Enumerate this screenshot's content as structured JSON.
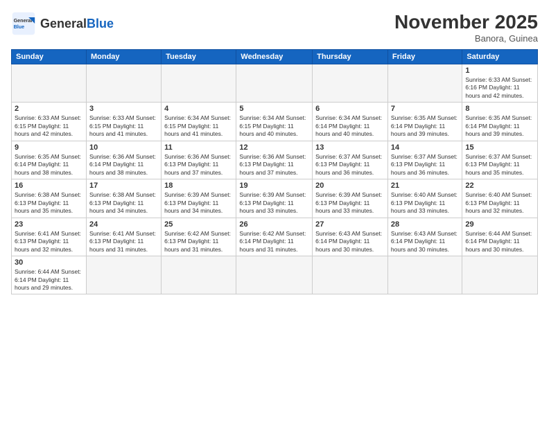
{
  "logo": {
    "text_general": "General",
    "text_blue": "Blue"
  },
  "header": {
    "month": "November 2025",
    "location": "Banora, Guinea"
  },
  "weekdays": [
    "Sunday",
    "Monday",
    "Tuesday",
    "Wednesday",
    "Thursday",
    "Friday",
    "Saturday"
  ],
  "weeks": [
    [
      {
        "day": "",
        "info": ""
      },
      {
        "day": "",
        "info": ""
      },
      {
        "day": "",
        "info": ""
      },
      {
        "day": "",
        "info": ""
      },
      {
        "day": "",
        "info": ""
      },
      {
        "day": "",
        "info": ""
      },
      {
        "day": "1",
        "info": "Sunrise: 6:33 AM\nSunset: 6:16 PM\nDaylight: 11 hours\nand 42 minutes."
      }
    ],
    [
      {
        "day": "2",
        "info": "Sunrise: 6:33 AM\nSunset: 6:15 PM\nDaylight: 11 hours\nand 42 minutes."
      },
      {
        "day": "3",
        "info": "Sunrise: 6:33 AM\nSunset: 6:15 PM\nDaylight: 11 hours\nand 41 minutes."
      },
      {
        "day": "4",
        "info": "Sunrise: 6:34 AM\nSunset: 6:15 PM\nDaylight: 11 hours\nand 41 minutes."
      },
      {
        "day": "5",
        "info": "Sunrise: 6:34 AM\nSunset: 6:15 PM\nDaylight: 11 hours\nand 40 minutes."
      },
      {
        "day": "6",
        "info": "Sunrise: 6:34 AM\nSunset: 6:14 PM\nDaylight: 11 hours\nand 40 minutes."
      },
      {
        "day": "7",
        "info": "Sunrise: 6:35 AM\nSunset: 6:14 PM\nDaylight: 11 hours\nand 39 minutes."
      },
      {
        "day": "8",
        "info": "Sunrise: 6:35 AM\nSunset: 6:14 PM\nDaylight: 11 hours\nand 39 minutes."
      }
    ],
    [
      {
        "day": "9",
        "info": "Sunrise: 6:35 AM\nSunset: 6:14 PM\nDaylight: 11 hours\nand 38 minutes."
      },
      {
        "day": "10",
        "info": "Sunrise: 6:36 AM\nSunset: 6:14 PM\nDaylight: 11 hours\nand 38 minutes."
      },
      {
        "day": "11",
        "info": "Sunrise: 6:36 AM\nSunset: 6:13 PM\nDaylight: 11 hours\nand 37 minutes."
      },
      {
        "day": "12",
        "info": "Sunrise: 6:36 AM\nSunset: 6:13 PM\nDaylight: 11 hours\nand 37 minutes."
      },
      {
        "day": "13",
        "info": "Sunrise: 6:37 AM\nSunset: 6:13 PM\nDaylight: 11 hours\nand 36 minutes."
      },
      {
        "day": "14",
        "info": "Sunrise: 6:37 AM\nSunset: 6:13 PM\nDaylight: 11 hours\nand 36 minutes."
      },
      {
        "day": "15",
        "info": "Sunrise: 6:37 AM\nSunset: 6:13 PM\nDaylight: 11 hours\nand 35 minutes."
      }
    ],
    [
      {
        "day": "16",
        "info": "Sunrise: 6:38 AM\nSunset: 6:13 PM\nDaylight: 11 hours\nand 35 minutes."
      },
      {
        "day": "17",
        "info": "Sunrise: 6:38 AM\nSunset: 6:13 PM\nDaylight: 11 hours\nand 34 minutes."
      },
      {
        "day": "18",
        "info": "Sunrise: 6:39 AM\nSunset: 6:13 PM\nDaylight: 11 hours\nand 34 minutes."
      },
      {
        "day": "19",
        "info": "Sunrise: 6:39 AM\nSunset: 6:13 PM\nDaylight: 11 hours\nand 33 minutes."
      },
      {
        "day": "20",
        "info": "Sunrise: 6:39 AM\nSunset: 6:13 PM\nDaylight: 11 hours\nand 33 minutes."
      },
      {
        "day": "21",
        "info": "Sunrise: 6:40 AM\nSunset: 6:13 PM\nDaylight: 11 hours\nand 33 minutes."
      },
      {
        "day": "22",
        "info": "Sunrise: 6:40 AM\nSunset: 6:13 PM\nDaylight: 11 hours\nand 32 minutes."
      }
    ],
    [
      {
        "day": "23",
        "info": "Sunrise: 6:41 AM\nSunset: 6:13 PM\nDaylight: 11 hours\nand 32 minutes."
      },
      {
        "day": "24",
        "info": "Sunrise: 6:41 AM\nSunset: 6:13 PM\nDaylight: 11 hours\nand 31 minutes."
      },
      {
        "day": "25",
        "info": "Sunrise: 6:42 AM\nSunset: 6:13 PM\nDaylight: 11 hours\nand 31 minutes."
      },
      {
        "day": "26",
        "info": "Sunrise: 6:42 AM\nSunset: 6:14 PM\nDaylight: 11 hours\nand 31 minutes."
      },
      {
        "day": "27",
        "info": "Sunrise: 6:43 AM\nSunset: 6:14 PM\nDaylight: 11 hours\nand 30 minutes."
      },
      {
        "day": "28",
        "info": "Sunrise: 6:43 AM\nSunset: 6:14 PM\nDaylight: 11 hours\nand 30 minutes."
      },
      {
        "day": "29",
        "info": "Sunrise: 6:44 AM\nSunset: 6:14 PM\nDaylight: 11 hours\nand 30 minutes."
      }
    ],
    [
      {
        "day": "30",
        "info": "Sunrise: 6:44 AM\nSunset: 6:14 PM\nDaylight: 11 hours\nand 29 minutes."
      },
      {
        "day": "",
        "info": ""
      },
      {
        "day": "",
        "info": ""
      },
      {
        "day": "",
        "info": ""
      },
      {
        "day": "",
        "info": ""
      },
      {
        "day": "",
        "info": ""
      },
      {
        "day": "",
        "info": ""
      }
    ]
  ]
}
